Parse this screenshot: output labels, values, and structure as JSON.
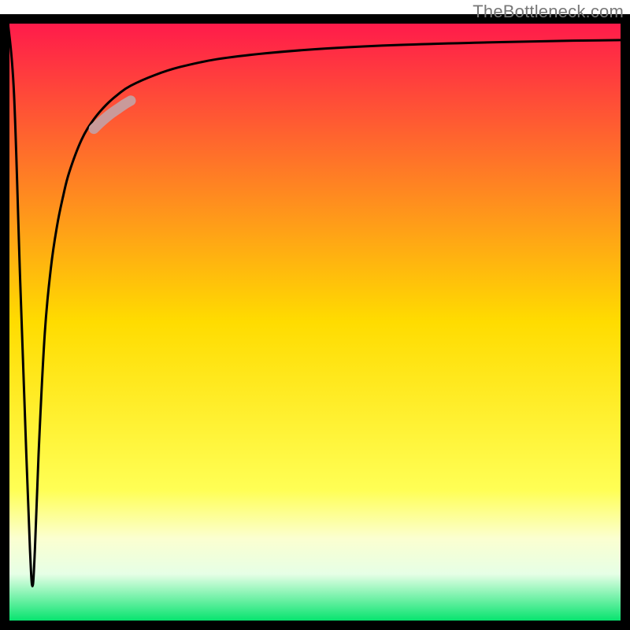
{
  "watermark": "TheBottleneck.com",
  "chart_data": {
    "type": "line",
    "title": "",
    "xlabel": "",
    "ylabel": "",
    "xlim": [
      0,
      100
    ],
    "ylim": [
      0,
      100
    ],
    "grid": false,
    "legend": false,
    "background_gradient": {
      "stops": [
        {
          "offset": 0.0,
          "color": "#ff1a4b"
        },
        {
          "offset": 0.5,
          "color": "#ffdc00"
        },
        {
          "offset": 0.78,
          "color": "#ffff55"
        },
        {
          "offset": 0.86,
          "color": "#fbffd0"
        },
        {
          "offset": 0.92,
          "color": "#e6ffe6"
        },
        {
          "offset": 1.0,
          "color": "#00e36b"
        }
      ]
    },
    "series": [
      {
        "name": "curve",
        "x": [
          0.0,
          1.0,
          2.0,
          3.0,
          3.6,
          4.0,
          4.4,
          5.0,
          6.0,
          7.0,
          8.0,
          9.0,
          10.0,
          12.0,
          14.0,
          16.0,
          18.0,
          20.0,
          24.0,
          28.0,
          34.0,
          42.0,
          52.0,
          64.0,
          78.0,
          92.0,
          100.0
        ],
        "y": [
          100.0,
          88.0,
          57.0,
          28.0,
          12.0,
          6.0,
          12.0,
          28.0,
          48.0,
          59.0,
          66.0,
          71.0,
          75.0,
          80.4,
          83.8,
          86.2,
          88.0,
          89.4,
          91.2,
          92.5,
          93.8,
          94.8,
          95.6,
          96.2,
          96.6,
          96.9,
          97.0
        ]
      },
      {
        "name": "magnifier_segment",
        "x": [
          14.0,
          15.0,
          16.0,
          17.0,
          18.0,
          19.0,
          20.0
        ],
        "y": [
          82.2,
          83.2,
          84.1,
          84.9,
          85.6,
          86.3,
          86.9
        ]
      }
    ],
    "annotations": []
  }
}
